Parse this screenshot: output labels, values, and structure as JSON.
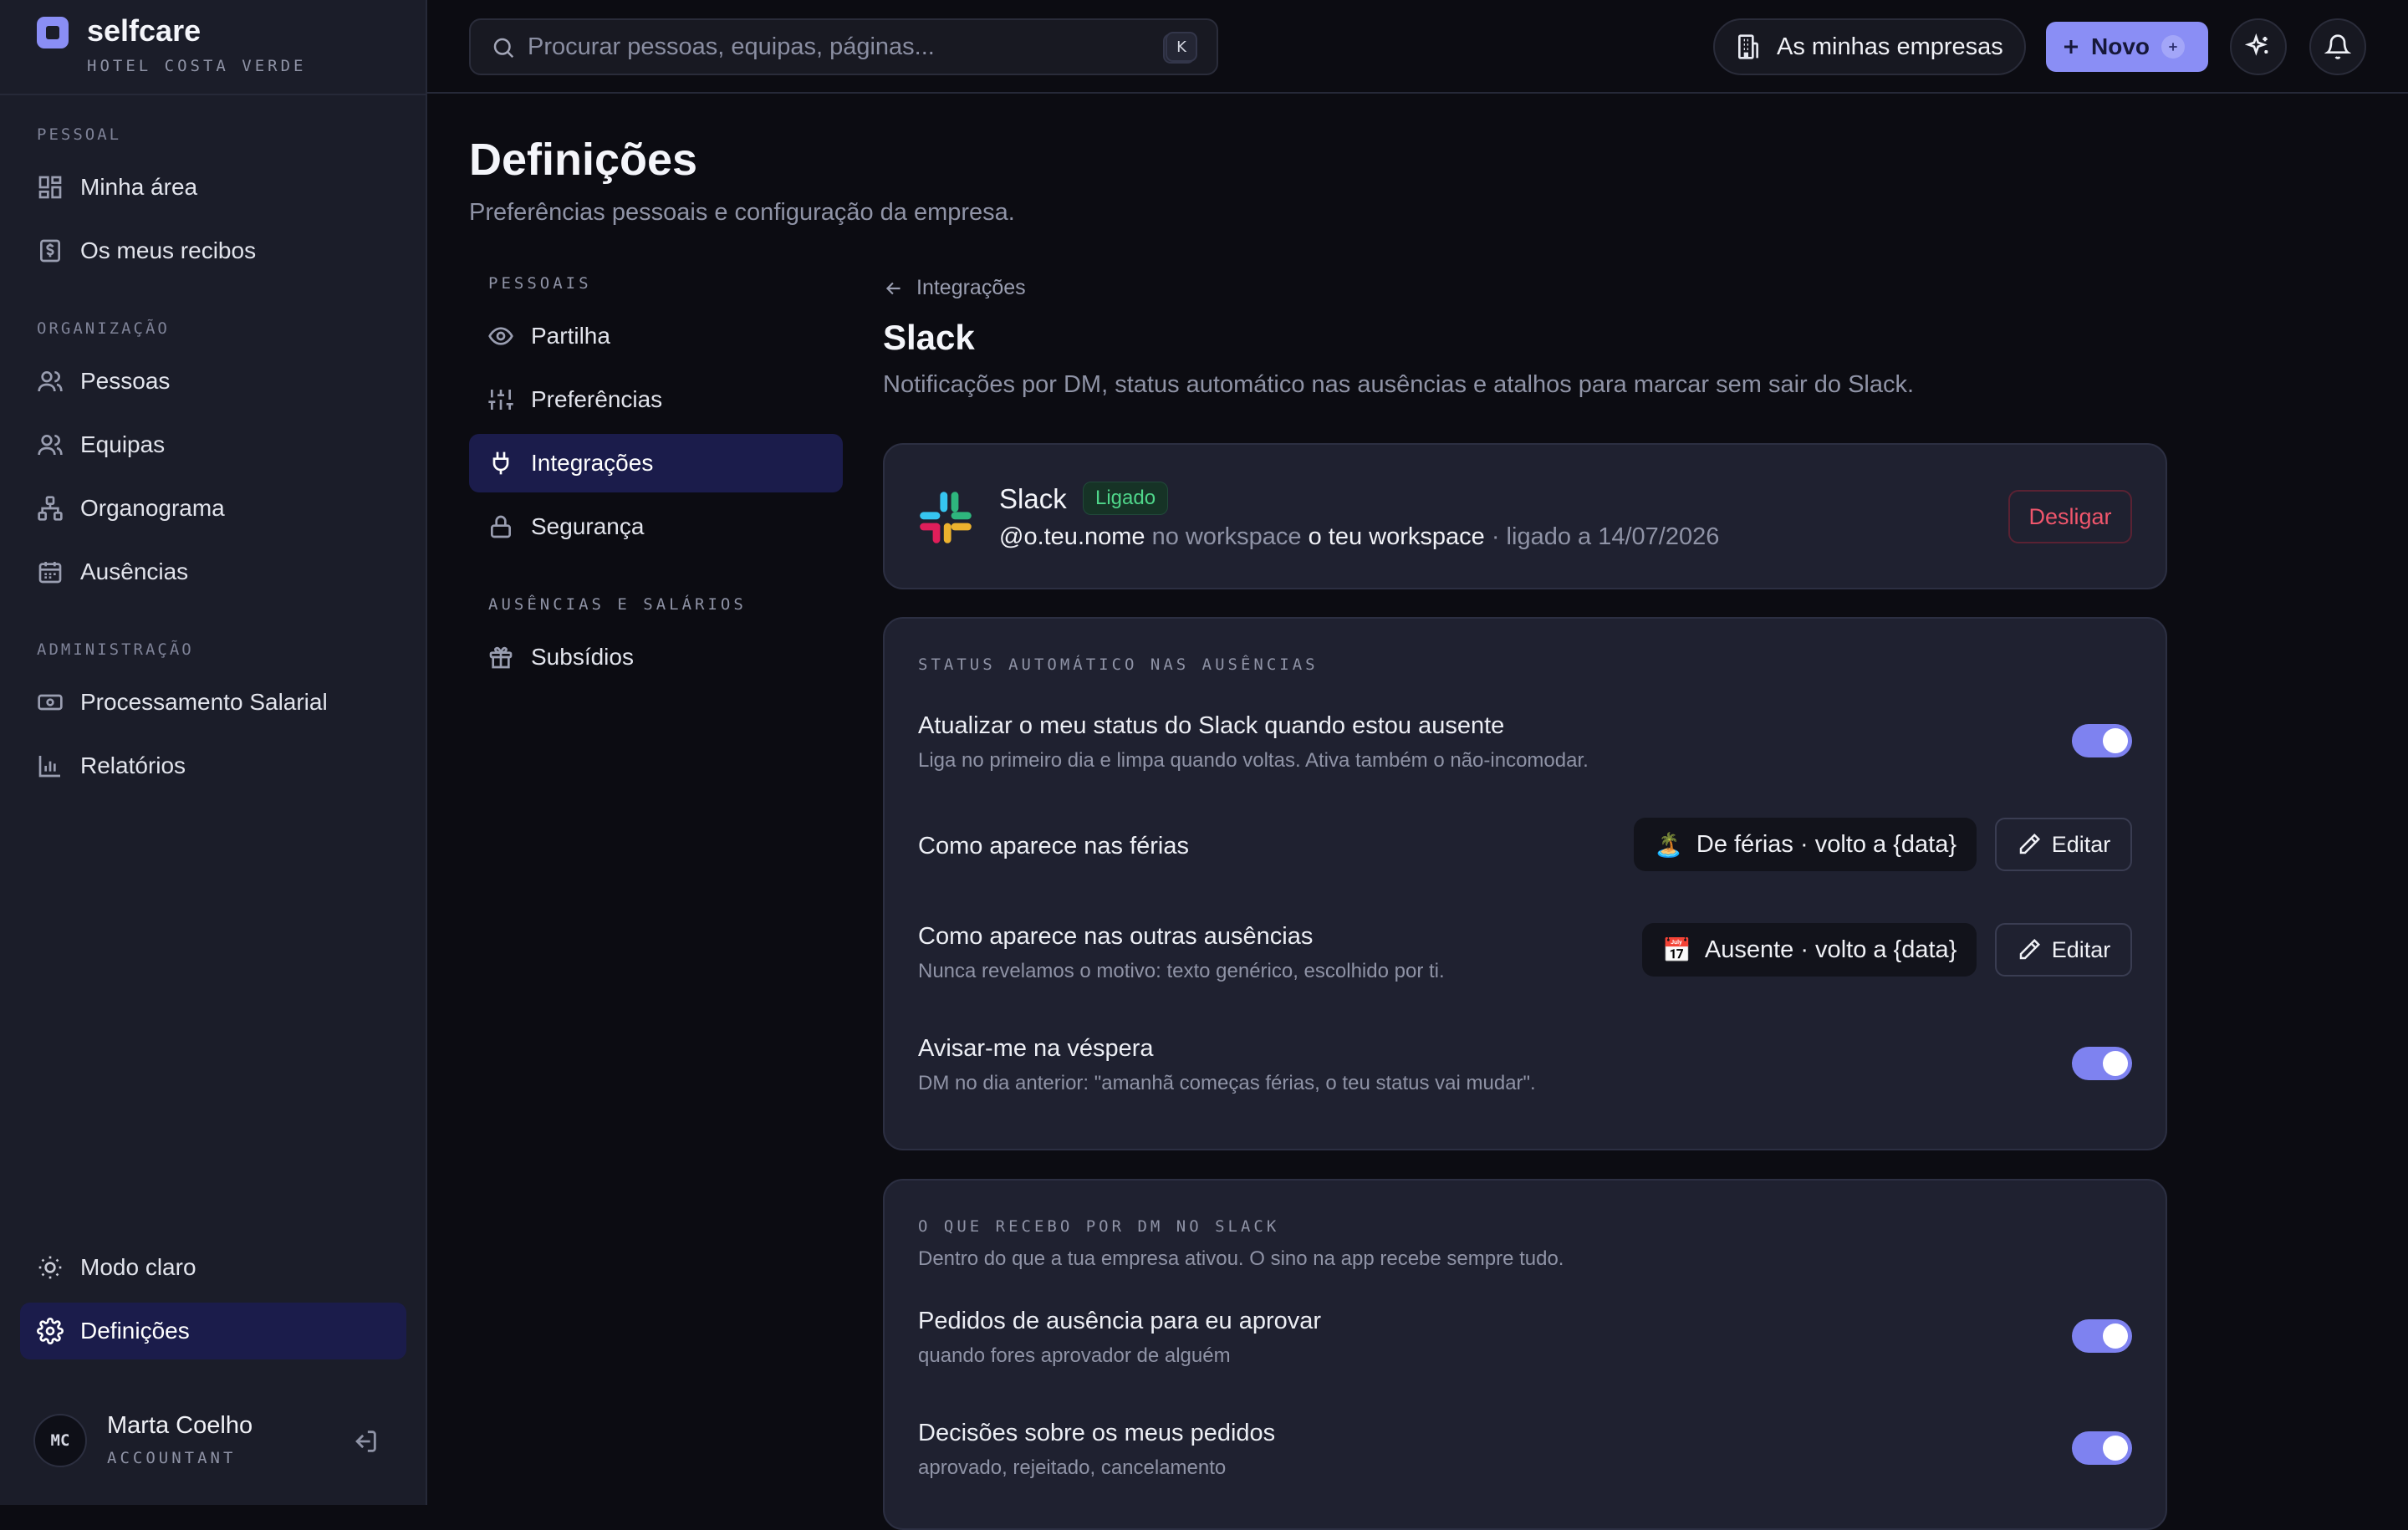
{
  "brand": {
    "name": "selfcare",
    "subtitle": "HOTEL COSTA VERDE"
  },
  "sidebar": {
    "sections": [
      {
        "label": "PESSOAL",
        "items": [
          {
            "label": "Minha área",
            "icon": "dashboard-grid-icon"
          },
          {
            "label": "Os meus recibos",
            "icon": "receipt-icon"
          }
        ]
      },
      {
        "label": "ORGANIZAÇÃO",
        "items": [
          {
            "label": "Pessoas",
            "icon": "users-icon"
          },
          {
            "label": "Equipas",
            "icon": "team-icon"
          },
          {
            "label": "Organograma",
            "icon": "org-chart-icon"
          },
          {
            "label": "Ausências",
            "icon": "calendar-icon"
          }
        ]
      },
      {
        "label": "ADMINISTRAÇÃO",
        "items": [
          {
            "label": "Processamento Salarial",
            "icon": "banknote-icon"
          },
          {
            "label": "Relatórios",
            "icon": "bar-chart-icon"
          }
        ]
      }
    ],
    "bottom": {
      "theme_toggle": "Modo claro",
      "settings": "Definições"
    },
    "profile": {
      "initials": "MC",
      "name": "Marta Coelho",
      "role": "ACCOUNTANT"
    }
  },
  "topbar": {
    "search_placeholder": "Procurar pessoas, equipas, páginas...",
    "shortcut_keys": [
      "⌘",
      "K"
    ],
    "companies_button": "As minhas empresas",
    "new_button": "Novo"
  },
  "page": {
    "title": "Definições",
    "subtitle": "Preferências pessoais e configuração da empresa."
  },
  "subnav": {
    "sections": [
      {
        "label": "PESSOAIS",
        "items": [
          {
            "label": "Partilha",
            "icon": "eye-icon"
          },
          {
            "label": "Preferências",
            "icon": "sliders-icon"
          },
          {
            "label": "Integrações",
            "icon": "plug-icon",
            "active": true
          },
          {
            "label": "Segurança",
            "icon": "lock-icon"
          }
        ]
      },
      {
        "label": "AUSÊNCIAS E SALÁRIOS",
        "items": [
          {
            "label": "Subsídios",
            "icon": "gift-icon"
          }
        ]
      }
    ]
  },
  "integration": {
    "breadcrumb": "Integrações",
    "title": "Slack",
    "description": "Notificações por DM, status automático nas ausências e atalhos para marcar sem sair do Slack.",
    "connection": {
      "name": "Slack",
      "status": "Ligado",
      "handle": "@o.teu.nome",
      "in_workspace": "no workspace",
      "workspace": "o teu workspace",
      "connected_on": "· ligado a 14/07/2026",
      "disconnect": "Desligar"
    },
    "auto_status": {
      "label": "STATUS AUTOMÁTICO NAS AUSÊNCIAS",
      "update_status": {
        "title": "Atualizar o meu status do Slack quando estou ausente",
        "desc": "Liga no primeiro dia e limpa quando voltas. Ativa também o não-incomodar.",
        "enabled": true
      },
      "vacation": {
        "title": "Como aparece nas férias",
        "emoji": "🏝️",
        "status": "De férias · volto a {data}",
        "edit": "Editar"
      },
      "other": {
        "title": "Como aparece nas outras ausências",
        "desc": "Nunca revelamos o motivo: texto genérico, escolhido por ti.",
        "emoji": "📅",
        "status": "Ausente · volto a {data}",
        "edit": "Editar"
      },
      "eve": {
        "title": "Avisar-me na véspera",
        "desc": "DM no dia anterior: \"amanhã começas férias, o teu status vai mudar\".",
        "enabled": true
      }
    },
    "dm": {
      "label": "O QUE RECEBO POR DM NO SLACK",
      "subtitle": "Dentro do que a tua empresa ativou. O sino na app recebe sempre tudo.",
      "approvals": {
        "title": "Pedidos de ausência para eu aprovar",
        "desc": "quando fores aprovador de alguém",
        "enabled": true
      },
      "decisions": {
        "title": "Decisões sobre os meus pedidos",
        "desc": "aprovado, rejeitado, cancelamento",
        "enabled": true
      }
    }
  },
  "colors": {
    "accent": "#8a8ef5",
    "toggle_on": "#7e82f0",
    "success": "#4fd68a",
    "danger": "#f0566c"
  }
}
